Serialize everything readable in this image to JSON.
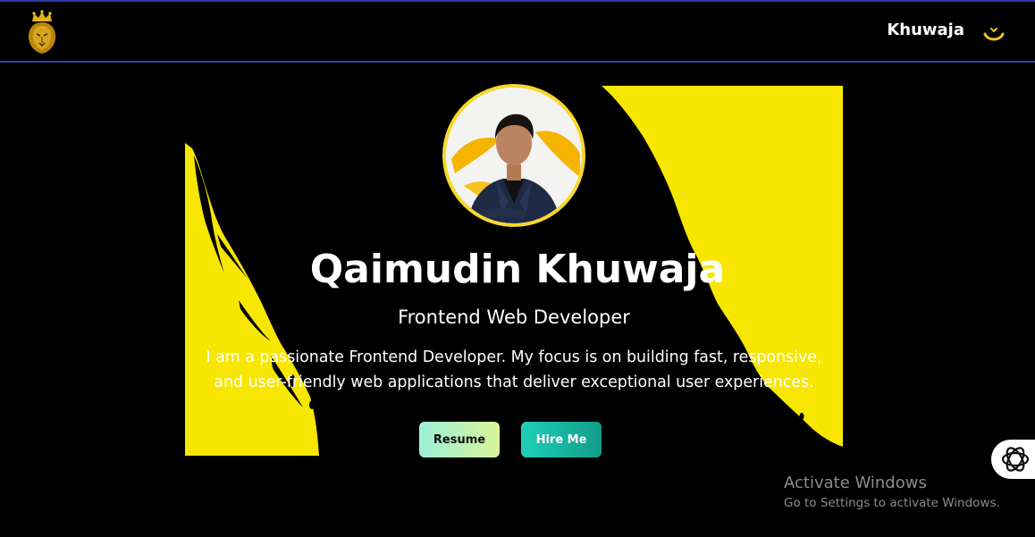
{
  "navbar": {
    "brand": "Khuwaja",
    "logo_icon": "crowned-lion-logo",
    "toggle_icon": "moon-toggle-icon"
  },
  "hero": {
    "name": "Qaimudin Khuwaja",
    "role": "Frontend Web Developer",
    "description": "I am a passionate Frontend Developer. My focus is on building fast, responsive, and user-friendly web applications that deliver exceptional user experiences.",
    "buttons": {
      "resume": "Resume",
      "hire": "Hire Me"
    }
  },
  "watermark": {
    "title": "Activate Windows",
    "subtitle": "Go to Settings to activate Windows."
  },
  "colors": {
    "background": "#000000",
    "accent_yellow": "#f7e600",
    "nav_border": "#2b3db0",
    "resume_gradient": [
      "#9cf0d8",
      "#d8f59a"
    ],
    "hire_gradient": [
      "#1fcfb7",
      "#129c8a"
    ]
  }
}
